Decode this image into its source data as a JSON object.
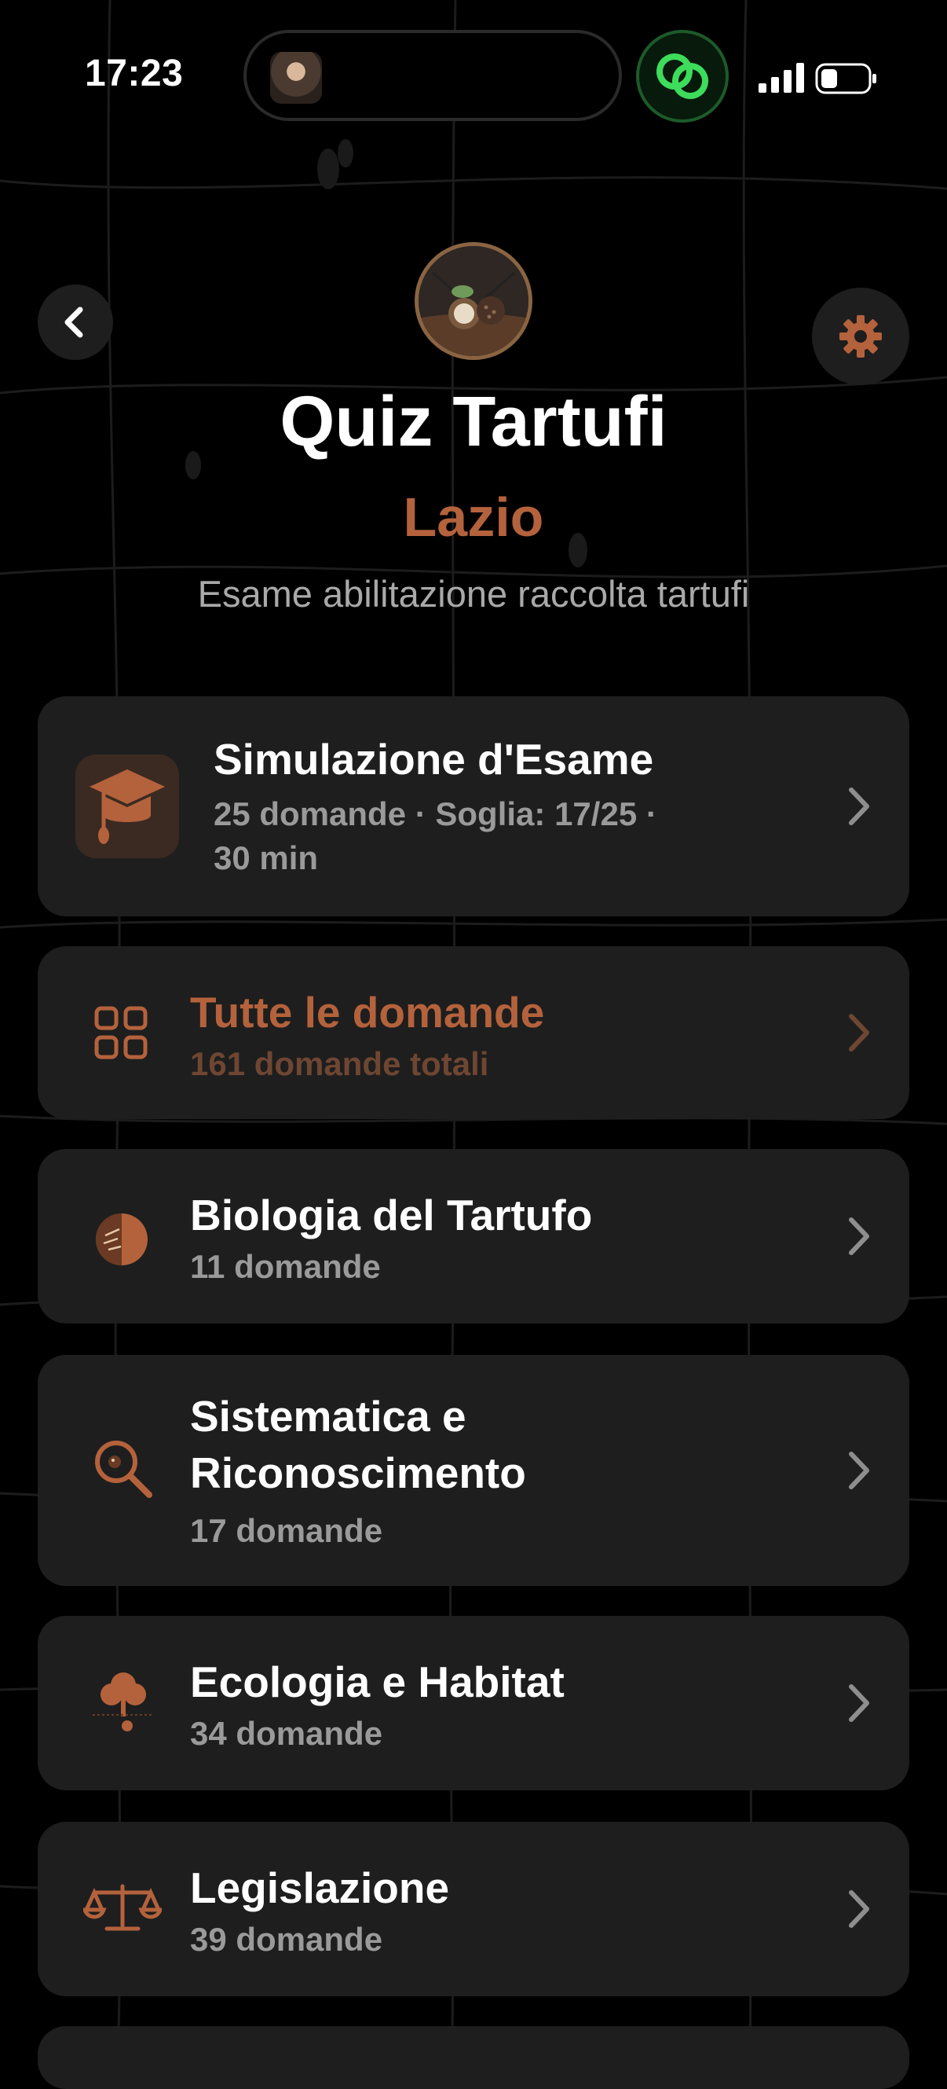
{
  "status_bar": {
    "time": "17:23",
    "icons": [
      "island-avatar",
      "link-activity-icon",
      "cellular-signal-icon",
      "battery-icon"
    ]
  },
  "header": {
    "back_icon": "chevron-left-icon",
    "settings_icon": "gear-icon",
    "title": "Quiz Tartufi",
    "region": "Lazio",
    "tagline": "Esame abilitazione raccolta tartufi"
  },
  "colors": {
    "accent": "#b4623c",
    "card_bg": "#1e1e1e",
    "background": "#000000",
    "muted": "#9a9a9a"
  },
  "exam_card": {
    "title": "Simulazione d'Esame",
    "subtitle_line1": "25 domande · Soglia: 17/25 ·",
    "subtitle_line2": "30 min",
    "icon": "graduation-cap-icon"
  },
  "all_questions": {
    "title": "Tutte le domande",
    "subtitle": "161 domande totali",
    "icon": "grid-icon"
  },
  "categories": [
    {
      "title": "Biologia del Tartufo",
      "subtitle": "11 domande",
      "icon": "truffle-section-icon"
    },
    {
      "title_line1": "Sistematica e",
      "title_line2": "Riconoscimento",
      "subtitle": "17 domande",
      "icon": "magnifier-icon"
    },
    {
      "title": "Ecologia e Habitat",
      "subtitle": "34 domande",
      "icon": "tree-icon"
    },
    {
      "title": "Legislazione",
      "subtitle": "39 domande",
      "icon": "scales-icon"
    }
  ]
}
